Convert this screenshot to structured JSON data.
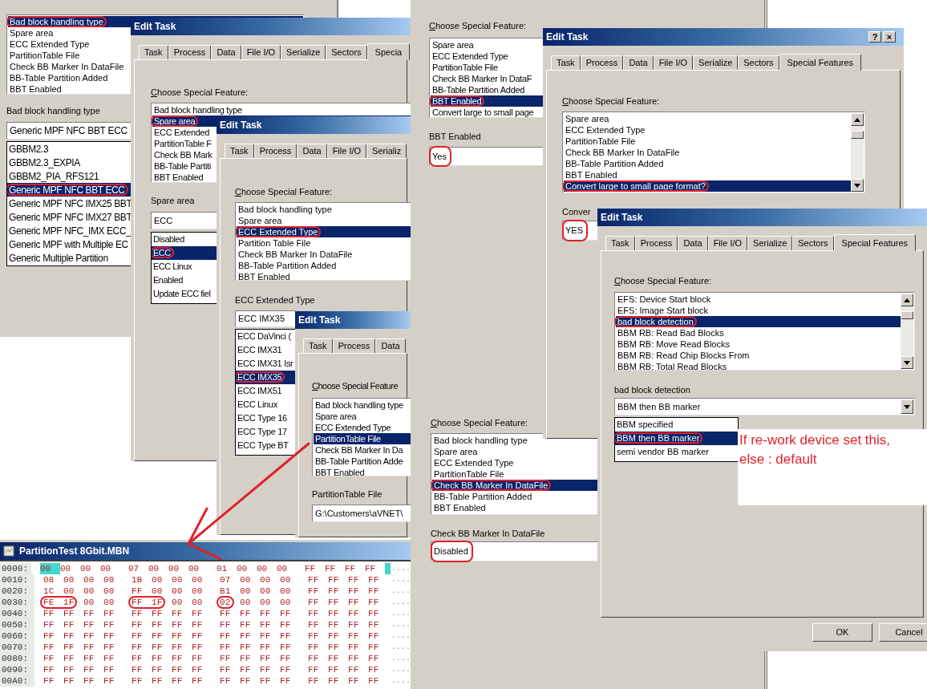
{
  "windows": [
    {
      "kind": "panel",
      "features": [
        {
          "label": "Bad block handling type",
          "selected": true
        },
        {
          "label": "Spare area",
          "selected": false
        },
        {
          "label": "ECC Extended Type",
          "selected": false
        },
        {
          "label": "PartitionTable File",
          "selected": false
        },
        {
          "label": "Check BB Marker In DataFile",
          "selected": false
        },
        {
          "label": "BB-Table Partition Added",
          "selected": false
        },
        {
          "label": "BBT Enabled",
          "selected": false
        }
      ],
      "value_label": "Bad block handling type",
      "value": "Generic MPF NFC BBT ECC",
      "options": [
        {
          "label": "GBBM2.3",
          "selected": false
        },
        {
          "label": "GBBM2.3_EXPIA",
          "selected": false
        },
        {
          "label": "GBBM2_PIA_RFS121",
          "selected": false
        },
        {
          "label": "Generic MPF NFC BBT ECC",
          "selected": true
        },
        {
          "label": "Generic MPF NFC IMX25 BBT",
          "selected": false
        },
        {
          "label": "Generic MPF NFC IMX27 BBT",
          "selected": false
        },
        {
          "label": "Generic MPF NFC_IMX ECC_",
          "selected": false
        },
        {
          "label": "Generic MPF with Multiple EC",
          "selected": false
        },
        {
          "label": "Generic Multiple Partition",
          "selected": false
        }
      ]
    },
    {
      "kind": "dialog",
      "title": "Edit Task",
      "tabs": [
        {
          "label": "Task",
          "selected": false
        },
        {
          "label": "Process",
          "selected": false
        },
        {
          "label": "Data",
          "selected": false
        },
        {
          "label": "File I/O",
          "selected": false
        },
        {
          "label": "Serialize",
          "selected": false
        },
        {
          "label": "Sectors",
          "selected": false
        },
        {
          "label": "Specia",
          "selected": true
        }
      ],
      "feature_label": "Choose Special Feature:",
      "features": [
        {
          "label": "Bad block handling type",
          "selected": false
        },
        {
          "label": "Spare area",
          "selected": true
        },
        {
          "label": "ECC Extended",
          "selected": false
        },
        {
          "label": "PartitionTable F",
          "selected": false
        },
        {
          "label": "Check BB Mark",
          "selected": false
        },
        {
          "label": "BB-Table Partiti",
          "selected": false
        },
        {
          "label": "BBT Enabled",
          "selected": false
        }
      ],
      "value_label": "Spare area",
      "value": "ECC",
      "options": [
        {
          "label": "Disabled",
          "selected": false
        },
        {
          "label": "ECC",
          "selected": true
        },
        {
          "label": "ECC Linux",
          "selected": false
        },
        {
          "label": "Enabled",
          "selected": false
        },
        {
          "label": "Update ECC fiel",
          "selected": false
        }
      ]
    },
    {
      "kind": "dialog",
      "title": "Edit Task",
      "tabs": [
        {
          "label": "Task",
          "selected": false
        },
        {
          "label": "Process",
          "selected": false
        },
        {
          "label": "Data",
          "selected": false
        },
        {
          "label": "File I/O",
          "selected": false
        },
        {
          "label": "Serializ",
          "selected": false
        }
      ],
      "feature_label": "Choose Special Feature:",
      "features": [
        {
          "label": "Bad block handling type",
          "selected": false
        },
        {
          "label": "Spare area",
          "selected": false
        },
        {
          "label": "ECC Extended Type",
          "selected": true
        },
        {
          "label": "Partition Table File",
          "selected": false
        },
        {
          "label": "Check BB Marker In DataFile",
          "selected": false
        },
        {
          "label": "BB-Table Partition Added",
          "selected": false
        },
        {
          "label": "BBT Enabled",
          "selected": false
        }
      ],
      "value_label": "ECC Extended Type",
      "value": "ECC IMX35",
      "options": [
        {
          "label": "ECC DaVinci (",
          "selected": false
        },
        {
          "label": "ECC IMX31",
          "selected": false
        },
        {
          "label": "ECC IMX31 Isr",
          "selected": false
        },
        {
          "label": "ECC IMX35",
          "selected": true
        },
        {
          "label": "ECC IMX51",
          "selected": false
        },
        {
          "label": "ECC Linux",
          "selected": false
        },
        {
          "label": "ECC Type 16",
          "selected": false
        },
        {
          "label": "ECC Type 17",
          "selected": false
        },
        {
          "label": "ECC Type BT",
          "selected": false
        }
      ]
    },
    {
      "kind": "dialog",
      "title": "Edit Task",
      "tabs": [
        {
          "label": "Task",
          "selected": false
        },
        {
          "label": "Process",
          "selected": false
        },
        {
          "label": "Data",
          "selected": false
        }
      ],
      "feature_label": "Choose Special Feature",
      "features": [
        {
          "label": "Bad block handling type",
          "selected": false
        },
        {
          "label": "Spare area",
          "selected": false
        },
        {
          "label": "ECC Extended Type",
          "selected": false
        },
        {
          "label": "PartitionTable File",
          "selected": true
        },
        {
          "label": "Check BB Marker In Da",
          "selected": false
        },
        {
          "label": "BB-Table Partition Adde",
          "selected": false
        },
        {
          "label": "BBT Enabled",
          "selected": false
        }
      ],
      "value_label": "PartitionTable File",
      "value": "G:\\Customers\\aVNET\\"
    },
    {
      "kind": "hex",
      "title": "PartitionTest 8Gbit.MBN",
      "rows": [
        {
          "offset": "0000:",
          "bytes": [
            "00",
            "00",
            "00",
            "00",
            "07",
            "00",
            "00",
            "00",
            "01",
            "00",
            "00",
            "00",
            "FF",
            "FF",
            "FF",
            "FF"
          ],
          "ascii": "....",
          "cursor": true
        },
        {
          "offset": "0010:",
          "bytes": [
            "08",
            "00",
            "00",
            "00",
            "1B",
            "00",
            "00",
            "00",
            "07",
            "00",
            "00",
            "00",
            "FF",
            "FF",
            "FF",
            "FF"
          ],
          "ascii": "....",
          "cursor": false
        },
        {
          "offset": "0020:",
          "bytes": [
            "1C",
            "00",
            "00",
            "00",
            "FF",
            "00",
            "00",
            "00",
            "B1",
            "00",
            "00",
            "00",
            "FF",
            "FF",
            "FF",
            "FF"
          ],
          "ascii": "....",
          "cursor": false
        },
        {
          "offset": "0030:",
          "bytes": [
            "FE",
            "1F",
            "00",
            "00",
            "FF",
            "1F",
            "00",
            "00",
            "02",
            "00",
            "00",
            "00",
            "FF",
            "FF",
            "FF",
            "FF"
          ],
          "ascii": "....",
          "cursor": false
        },
        {
          "offset": "0040:",
          "bytes": [
            "FF",
            "FF",
            "FF",
            "FF",
            "FF",
            "FF",
            "FF",
            "FF",
            "FF",
            "FF",
            "FF",
            "FF",
            "FF",
            "FF",
            "FF",
            "FF"
          ],
          "ascii": "....",
          "cursor": false
        },
        {
          "offset": "0050:",
          "bytes": [
            "FF",
            "FF",
            "FF",
            "FF",
            "FF",
            "FF",
            "FF",
            "FF",
            "FF",
            "FF",
            "FF",
            "FF",
            "FF",
            "FF",
            "FF",
            "FF"
          ],
          "ascii": "....",
          "cursor": false
        },
        {
          "offset": "0060:",
          "bytes": [
            "FF",
            "FF",
            "FF",
            "FF",
            "FF",
            "FF",
            "FF",
            "FF",
            "FF",
            "FF",
            "FF",
            "FF",
            "FF",
            "FF",
            "FF",
            "FF"
          ],
          "ascii": "....",
          "cursor": false
        },
        {
          "offset": "0070:",
          "bytes": [
            "FF",
            "FF",
            "FF",
            "FF",
            "FF",
            "FF",
            "FF",
            "FF",
            "FF",
            "FF",
            "FF",
            "FF",
            "FF",
            "FF",
            "FF",
            "FF"
          ],
          "ascii": "....",
          "cursor": false
        },
        {
          "offset": "0080:",
          "bytes": [
            "FF",
            "FF",
            "FF",
            "FF",
            "FF",
            "FF",
            "FF",
            "FF",
            "FF",
            "FF",
            "FF",
            "FF",
            "FF",
            "FF",
            "FF",
            "FF"
          ],
          "ascii": "....",
          "cursor": false
        },
        {
          "offset": "0090:",
          "bytes": [
            "FF",
            "FF",
            "FF",
            "FF",
            "FF",
            "FF",
            "FF",
            "FF",
            "FF",
            "FF",
            "FF",
            "FF",
            "FF",
            "FF",
            "FF",
            "FF"
          ],
          "ascii": "....",
          "cursor": false
        },
        {
          "offset": "00A0:",
          "bytes": [
            "FF",
            "FF",
            "FF",
            "FF",
            "FF",
            "FF",
            "FF",
            "FF",
            "FF",
            "FF",
            "FF",
            "FF",
            "FF",
            "FF",
            "FF",
            "FF"
          ],
          "ascii": "....",
          "cursor": false
        }
      ]
    },
    {
      "kind": "panel",
      "feature_label": "Choose Special Feature:",
      "features": [
        {
          "label": "Spare area",
          "selected": false
        },
        {
          "label": "ECC Extended Type",
          "selected": false
        },
        {
          "label": "PartitionTable File",
          "selected": false
        },
        {
          "label": "Check BB Marker In DataF",
          "selected": false
        },
        {
          "label": "BB-Table Partition Added",
          "selected": false
        },
        {
          "label": "BBT Enabled",
          "selected": true
        },
        {
          "label": "Convert large to small page",
          "selected": false
        }
      ],
      "value_label": "BBT Enabled",
      "value": "Yes"
    },
    {
      "kind": "panel",
      "feature_label": "Choose Special Feature:",
      "features": [
        {
          "label": "Bad block handling type",
          "selected": false
        },
        {
          "label": "Spare area",
          "selected": false
        },
        {
          "label": "ECC Extended Type",
          "selected": false
        },
        {
          "label": "PartitionTable File",
          "selected": false
        },
        {
          "label": "Check BB Marker In DataFile",
          "selected": true
        },
        {
          "label": "BB-Table Partition Added",
          "selected": false
        },
        {
          "label": "BBT Enabled",
          "selected": false
        }
      ],
      "value_label": "Check BB Marker In DataFile",
      "value": "Disabled"
    },
    {
      "kind": "dialog",
      "title": "Edit Task",
      "title_buttons": [
        "?",
        "×"
      ],
      "tabs": [
        {
          "label": "Task",
          "selected": false
        },
        {
          "label": "Process",
          "selected": false
        },
        {
          "label": "Data",
          "selected": false
        },
        {
          "label": "File I/O",
          "selected": false
        },
        {
          "label": "Serialize",
          "selected": false
        },
        {
          "label": "Sectors",
          "selected": false
        },
        {
          "label": "Special Features",
          "selected": true
        }
      ],
      "feature_label": "Choose Special Feature:",
      "features": [
        {
          "label": "Spare area",
          "selected": false
        },
        {
          "label": "ECC Extended Type",
          "selected": false
        },
        {
          "label": "PartitionTable File",
          "selected": false
        },
        {
          "label": "Check BB Marker In DataFile",
          "selected": false
        },
        {
          "label": "BB-Table Partition Added",
          "selected": false
        },
        {
          "label": "BBT Enabled",
          "selected": false
        },
        {
          "label": "Convert large to small page format?",
          "selected": true
        }
      ],
      "value_label": "Conver",
      "value": "YES"
    },
    {
      "kind": "dialog",
      "title": "Edit Task",
      "tabs": [
        {
          "label": "Task",
          "selected": false
        },
        {
          "label": "Process",
          "selected": false
        },
        {
          "label": "Data",
          "selected": false
        },
        {
          "label": "File I/O",
          "selected": false
        },
        {
          "label": "Serialize",
          "selected": false
        },
        {
          "label": "Sectors",
          "selected": false
        },
        {
          "label": "Special Features",
          "selected": true
        }
      ],
      "feature_label": "Choose Special Feature:",
      "features": [
        {
          "label": "EFS: Device Start block",
          "selected": false
        },
        {
          "label": "EFS: Image Start block",
          "selected": false
        },
        {
          "label": "bad block detection",
          "selected": true
        },
        {
          "label": "BBM RB: Read Bad Blocks",
          "selected": false
        },
        {
          "label": "BBM RB: Move Read Blocks",
          "selected": false
        },
        {
          "label": "BBM RB: Read Chip Blocks From",
          "selected": false
        },
        {
          "label": "BBM RB: Total Read Blocks",
          "selected": false
        }
      ],
      "value_label": "bad block detection",
      "value": "BBM then BB marker",
      "options": [
        {
          "label": "BBM specified",
          "selected": false
        },
        {
          "label": "BBM then BB marker",
          "selected": true
        },
        {
          "label": "semi vendor BB marker",
          "selected": false
        }
      ],
      "buttons": [
        "OK",
        "Cancel"
      ]
    }
  ],
  "note": "If re-work device set this, else : default"
}
